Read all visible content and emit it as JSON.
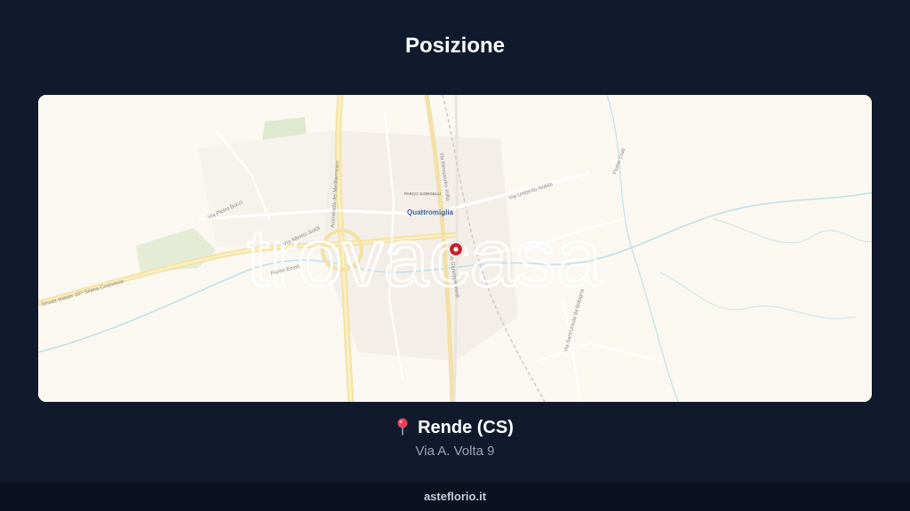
{
  "page": {
    "title": "Posizione"
  },
  "map": {
    "watermark": "trovacasa",
    "place_label": "Quattromiglia",
    "poi_label": "PARCO GIORGELLI",
    "street_labels": [
      "Via Pietro Bucci",
      "Via Alberto Sordi",
      "Autostrada del Mediterraneo",
      "Strada statale 107 Silana Crotonese",
      "Via Alessandro Volta",
      "Via Giuseppe Verdi",
      "Via Umberto Nobile",
      "Fiume Crati",
      "Fiume Emoli",
      "Via Sant'Ursula da Bologna"
    ],
    "marker": {
      "icon": "location-marker-icon",
      "color": "#c8202f"
    }
  },
  "location": {
    "icon": "pin-icon",
    "city": "Rende (CS)",
    "address": "Via A. Volta 9"
  },
  "footer": {
    "site": "asteflorio.it"
  }
}
